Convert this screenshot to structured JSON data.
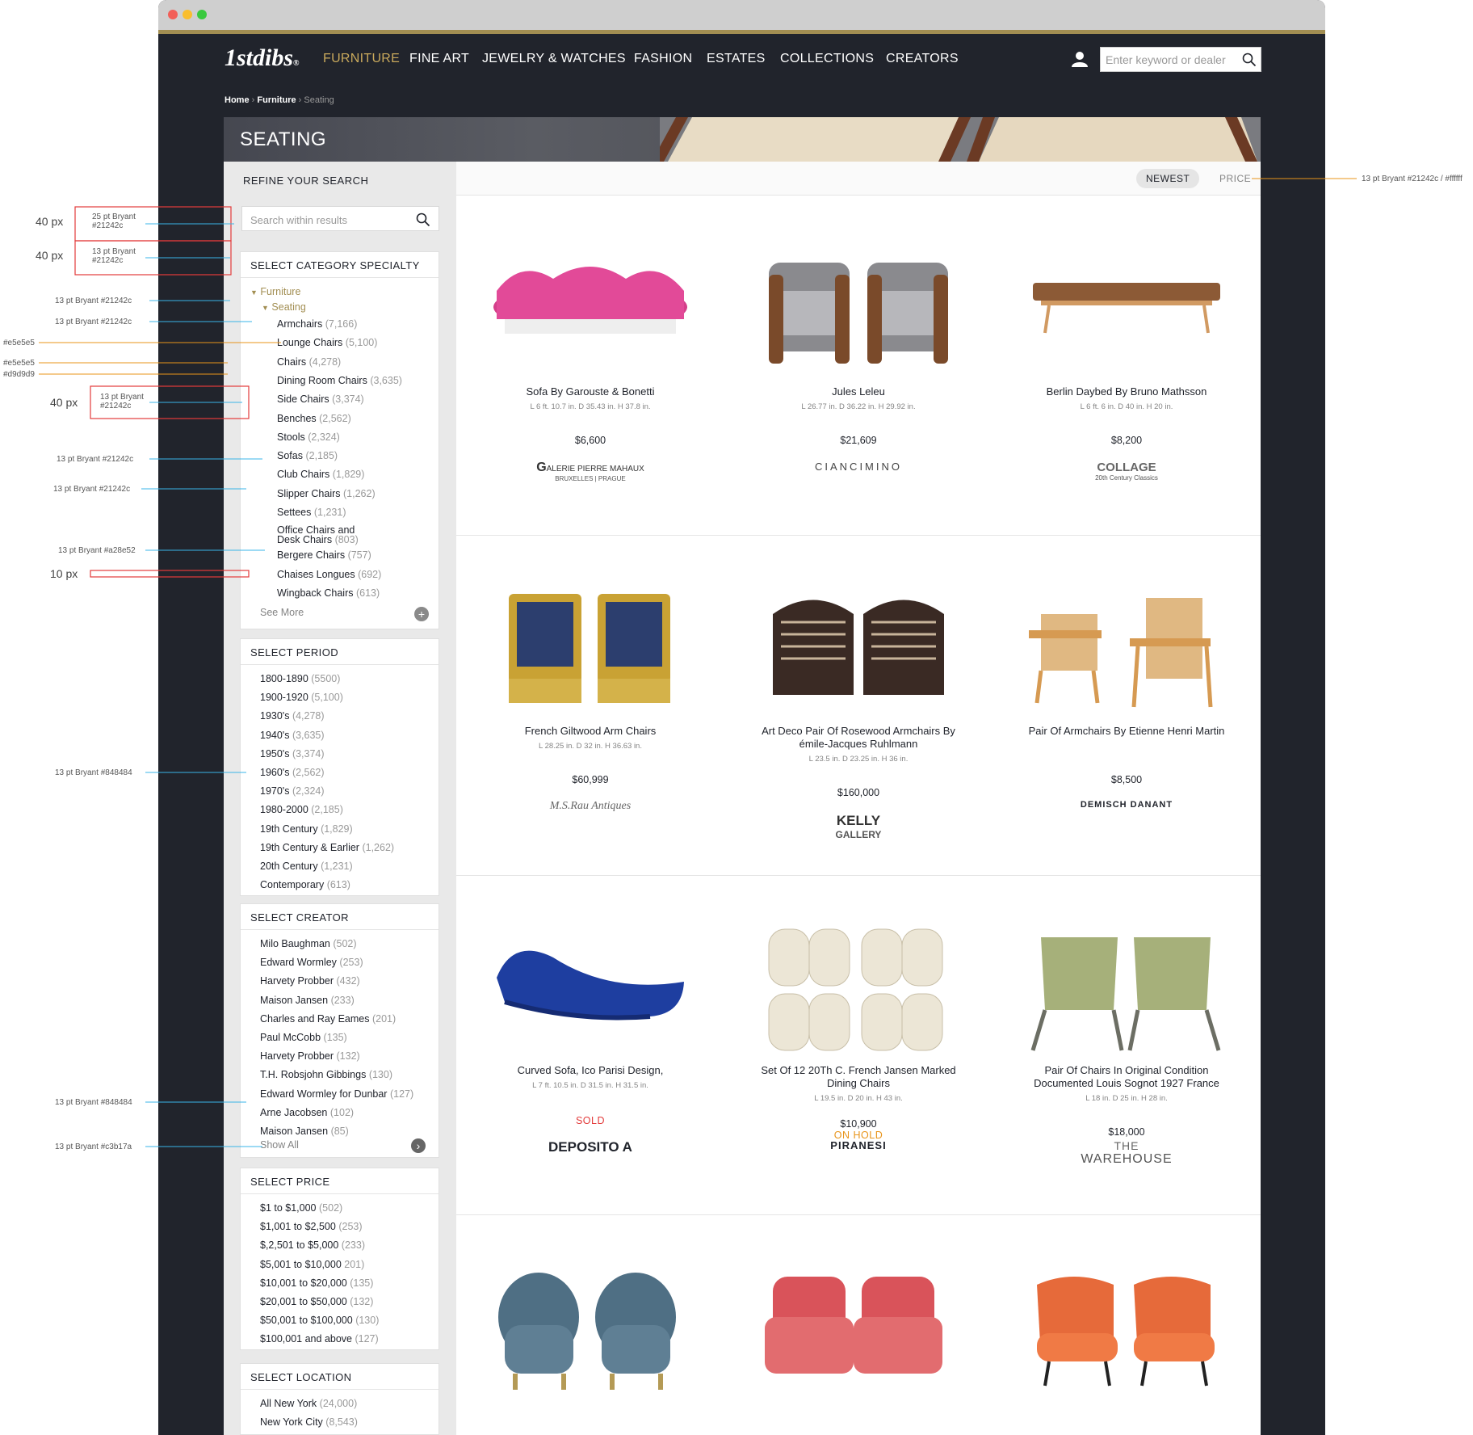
{
  "nav": {
    "logo": "1stdibs",
    "logo_mark": "®",
    "items": [
      "FURNITURE",
      "FINE ART",
      "JEWELRY & WATCHES",
      "FASHION",
      "ESTATES",
      "COLLECTIONS",
      "CREATORS"
    ],
    "search_placeholder": "Enter keyword or dealer"
  },
  "breadcrumb": [
    "Home",
    "Furniture",
    "Seating"
  ],
  "hero_title": "SEATING",
  "refine": "REFINE YOUR SEARCH",
  "search_within": "Search within results",
  "category": {
    "title": "SELECT CATEGORY SPECIALTY",
    "parent": "Furniture",
    "child": "Seating",
    "items": [
      {
        "label": "Armchairs",
        "count": "(7,166)"
      },
      {
        "label": "Lounge Chairs",
        "count": "(5,100)"
      },
      {
        "label": "Chairs",
        "count": "(4,278)"
      },
      {
        "label": "Dining Room Chairs",
        "count": "(3,635)"
      },
      {
        "label": "Side Chairs",
        "count": "(3,374)"
      },
      {
        "label": "Benches",
        "count": "(2,562)"
      },
      {
        "label": "Stools",
        "count": "(2,324)"
      },
      {
        "label": "Sofas",
        "count": "(2,185)"
      },
      {
        "label": "Club Chairs",
        "count": "(1,829)"
      },
      {
        "label": "Slipper Chairs",
        "count": "(1,262)"
      },
      {
        "label": "Settees",
        "count": "(1,231)"
      },
      {
        "label": "Office Chairs and",
        "label2": "Desk Chairs",
        "count": "(803)"
      },
      {
        "label": "Bergere Chairs",
        "count": "(757)"
      },
      {
        "label": "Chaises Longues",
        "count": "(692)"
      },
      {
        "label": "Wingback Chairs",
        "count": "(613)"
      }
    ],
    "see_more": "See More"
  },
  "period": {
    "title": "SELECT PERIOD",
    "items": [
      {
        "label": "1800-1890",
        "count": "(5500)"
      },
      {
        "label": "1900-1920",
        "count": "(5,100)"
      },
      {
        "label": "1930's",
        "count": "(4,278)"
      },
      {
        "label": "1940's",
        "count": "(3,635)"
      },
      {
        "label": "1950's",
        "count": "(3,374)"
      },
      {
        "label": "1960's",
        "count": "(2,562)"
      },
      {
        "label": "1970's",
        "count": "(2,324)"
      },
      {
        "label": "1980-2000",
        "count": "(2,185)"
      },
      {
        "label": "19th Century",
        "count": "(1,829)"
      },
      {
        "label": "19th Century & Earlier",
        "count": "(1,262)"
      },
      {
        "label": "20th Century",
        "count": "(1,231)"
      },
      {
        "label": "Contemporary",
        "count": "(613)"
      }
    ]
  },
  "creator": {
    "title": "SELECT CREATOR",
    "items": [
      {
        "label": "Milo Baughman",
        "count": "(502)"
      },
      {
        "label": "Edward Wormley",
        "count": "(253)"
      },
      {
        "label": "Harvety Probber",
        "count": "(432)"
      },
      {
        "label": "Maison Jansen",
        "count": "(233)"
      },
      {
        "label": "Charles and Ray Eames",
        "count": "(201)"
      },
      {
        "label": "Paul McCobb",
        "count": "(135)"
      },
      {
        "label": "Harvety Probber",
        "count": "(132)"
      },
      {
        "label": "T.H. Robsjohn Gibbings",
        "count": "(130)"
      },
      {
        "label": "Edward Wormley for Dunbar",
        "count": "(127)"
      },
      {
        "label": "Arne Jacobsen",
        "count": "(102)"
      },
      {
        "label": "Maison Jansen",
        "count": "(85)"
      }
    ],
    "show_all": "Show All"
  },
  "price": {
    "title": "SELECT PRICE",
    "items": [
      {
        "label": "$1 to $1,000",
        "count": "(502)"
      },
      {
        "label": "$1,001 to $2,500",
        "count": "(253)"
      },
      {
        "label": "$,2,501 to $5,000",
        "count": "(233)"
      },
      {
        "label": "$5,001 to $10,000",
        "count": "201)"
      },
      {
        "label": "$10,001 to $20,000",
        "count": "(135)"
      },
      {
        "label": "$20,001 to $50,000",
        "count": "(132)"
      },
      {
        "label": "$50,001 to $100,000",
        "count": "(130)"
      },
      {
        "label": "$100,001 and above",
        "count": "(127)"
      }
    ]
  },
  "location": {
    "title": "SELECT LOCATION",
    "items": [
      {
        "label": "All New York",
        "count": "(24,000)"
      },
      {
        "label": "New York City",
        "count": "(8,543)"
      }
    ]
  },
  "sort": {
    "newest": "NEWEST",
    "price": "PRICE"
  },
  "products": [
    {
      "name": "Sofa By Garouste & Bonetti",
      "name2": "",
      "dims": "L 6 ft. 10.7 in.  D 35.43 in.  H 37.8 in.",
      "price": "$6,600",
      "status": "",
      "dealer": "ALERIE PIERRE MAHAUX",
      "dealer_prefix": "G",
      "dealer_sub": "BRUXELLES | PRAGUE"
    },
    {
      "name": "Jules Leleu",
      "name2": "",
      "dims": "L 26.77 in.  D 36.22 in.  H 29.92 in.",
      "price": "$21,609",
      "status": "",
      "dealer": "CIANCIMINO"
    },
    {
      "name": "Berlin Daybed By Bruno Mathsson",
      "name2": "",
      "dims": "L 6 ft. 6 in.  D 40 in.  H 20 in.",
      "price": "$8,200",
      "status": "",
      "dealer": "COLLAGE",
      "dealer_sub": "20th Century Classics"
    },
    {
      "name": "French Giltwood Arm Chairs",
      "name2": "",
      "dims": "L 28.25 in.  D 32 in.  H 36.63 in.",
      "price": "$60,999",
      "status": "",
      "dealer": "M.S.Rau Antiques"
    },
    {
      "name": "Art Deco Pair Of Rosewood Armchairs By",
      "name2": "émile-Jacques Ruhlmann",
      "dims": "L 23.5 in.  D 23.25 in.  H 36 in.",
      "price": "$160,000",
      "status": "",
      "dealer": "KELLY",
      "dealer_sub": "GALLERY"
    },
    {
      "name": "Pair Of Armchairs By Etienne Henri Martin",
      "name2": "",
      "dims": "",
      "price": "$8,500",
      "status": "",
      "dealer": "DEMISCH DANANT"
    },
    {
      "name": "Curved Sofa, Ico Parisi Design,",
      "name2": "",
      "dims": "L 7 ft. 10.5 in.  D 31.5 in.  H 31.5 in.",
      "price": "",
      "status": "SOLD",
      "dealer": "DEPOSITO A"
    },
    {
      "name": "Set Of 12 20Th C. French Jansen Marked",
      "name2": "Dining Chairs",
      "dims": "L 19.5 in.  D 20 in.  H 43 in.",
      "price": "$10,900",
      "status": "ON HOLD",
      "dealer": "PIRANESI"
    },
    {
      "name": "Pair Of Chairs In Original Condition",
      "name2": "Documented Louis Sognot 1927 France",
      "dims": "L 18 in.  D 25 in.  H 28 in.",
      "price": "$18,000",
      "status": "",
      "dealer": "THE",
      "dealer_sub": "WAREHOUSE"
    }
  ],
  "annotations": {
    "search_box": "25 pt Bryant #21242c",
    "sort": "13 pt Bryant #21242c / #ffffff",
    "cat_header": "13 pt Bryant #21242c",
    "furniture": "13 pt Bryant #21242c",
    "seating": "13 pt Bryant #21242c",
    "e5": "#e5e5e5",
    "d9": "#d9d9d9",
    "item40": "13 pt Bryant #21242c",
    "sofas": "13 pt Bryant #21242c",
    "slipper": "13 pt Bryant #21242c",
    "bergere": "13 pt Bryant #a28e52",
    "period": "13 pt Bryant #848484",
    "creator": "13 pt Bryant #848484",
    "showall": "13 pt Bryant #c3b17a",
    "px40": "40 px",
    "px10": "10 px"
  },
  "colors": {
    "dark": "#21242c",
    "gold": "#a28e52",
    "grey": "#848484",
    "orange": "#e8941a",
    "red": "#e33b3b"
  }
}
